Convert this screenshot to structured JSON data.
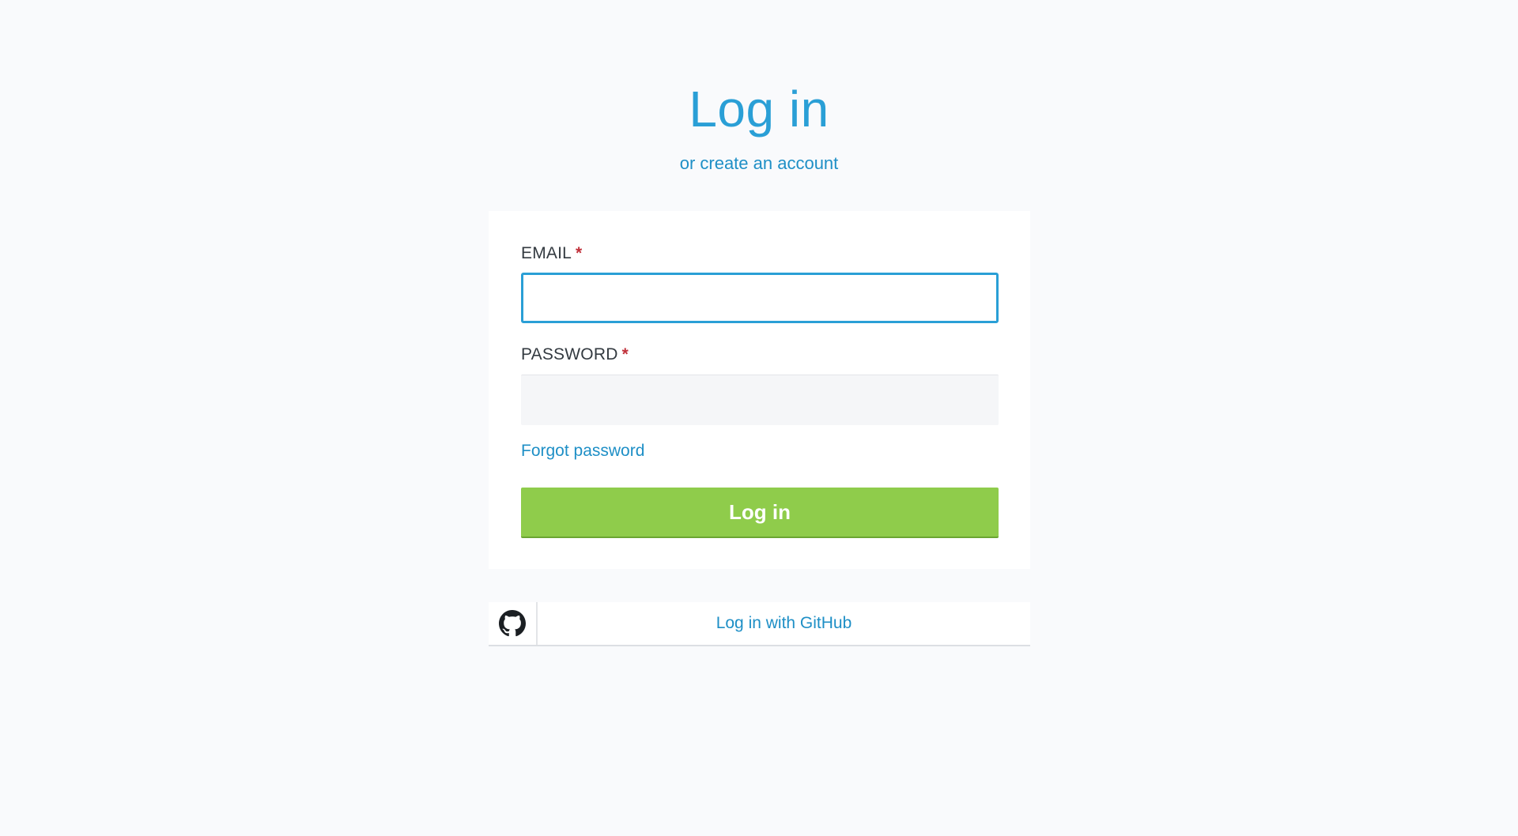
{
  "header": {
    "title": "Log in",
    "create_account_link": "or create an account"
  },
  "form": {
    "email": {
      "label": "EMAIL",
      "required_mark": "*",
      "value": "",
      "placeholder": ""
    },
    "password": {
      "label": "PASSWORD",
      "required_mark": "*",
      "value": "",
      "placeholder": ""
    },
    "forgot_password_link": "Forgot password",
    "submit_label": "Log in"
  },
  "oauth": {
    "github_label": "Log in with GitHub",
    "github_icon": "github-icon"
  },
  "colors": {
    "accent": "#2a9fd6",
    "link": "#1e8fc6",
    "button": "#8fcc4b",
    "required": "#c0303a",
    "background": "#f9fafc"
  }
}
